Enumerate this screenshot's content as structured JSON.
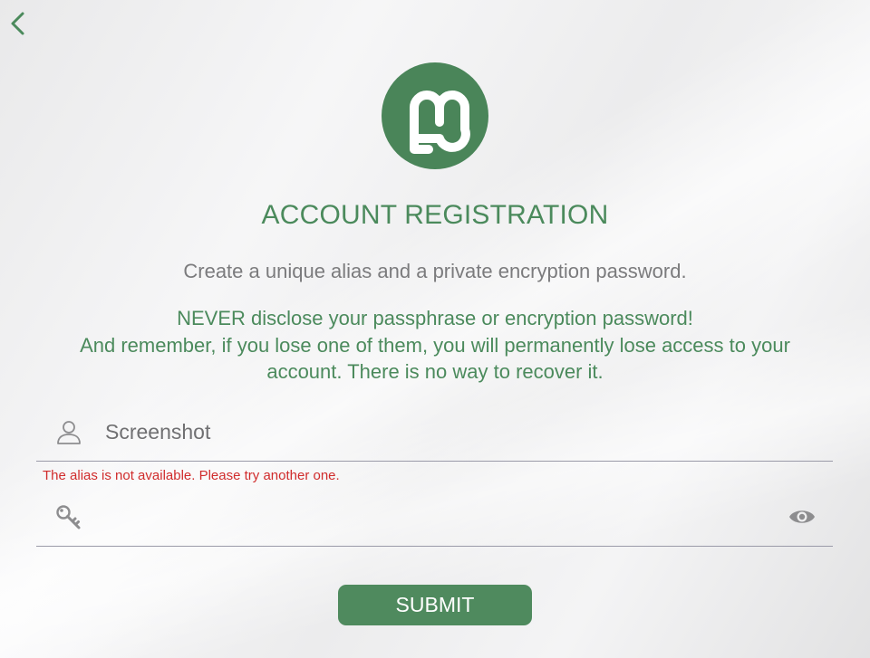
{
  "page": {
    "title": "ACCOUNT REGISTRATION",
    "subtitle": "Create a unique alias and a private encryption password.",
    "warning_lines": [
      "NEVER disclose your passphrase or encryption password!",
      "And remember, if you lose one of them, you will permanently lose access to your",
      "account. There is no way to recover it."
    ]
  },
  "navigation": {
    "back_icon": "chevron-left-icon"
  },
  "logo": {
    "icon": "app-logo-icon"
  },
  "alias_field": {
    "icon": "user-icon",
    "value": "Screenshot",
    "error": "The alias is not available. Please try another one."
  },
  "password_field": {
    "icon": "key-icon",
    "value": "",
    "toggle_icon": "eye-icon"
  },
  "submit": {
    "label": "SUBMIT"
  },
  "colors": {
    "accent": "#4b8a5c",
    "error": "#d02c2c",
    "text_muted": "#7b7b7d",
    "background": "#efeff0"
  }
}
